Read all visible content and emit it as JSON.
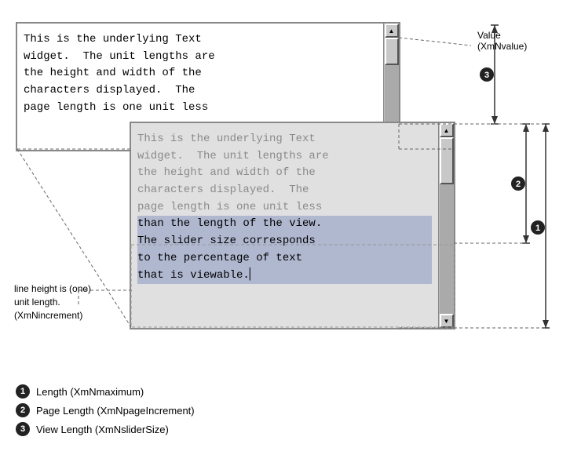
{
  "top_widget": {
    "text": "This is the underlying Text\nwidget.  The unit lengths are\nthe height and width of the\ncharacters displayed.  The\npage length is one unit less"
  },
  "bottom_widget": {
    "text_normal": "This is the underlying Text\nwidget.  The unit lengths are\nthe height and width of the\ncharacters displayed.  The\npage length is one unit less",
    "text_highlighted": "than the length of the view.\nThe slider size corresponds\nto the percentage of text\nthat is viewable.|"
  },
  "value_label": {
    "title": "Value",
    "subtitle": "(XmNvalue)"
  },
  "badges": {
    "one": "1",
    "two": "2",
    "three": "3"
  },
  "legend": [
    {
      "num": "1",
      "text": "Length (XmNmaximum)"
    },
    {
      "num": "2",
      "text": "Page Length (XmNpageIncrement)"
    },
    {
      "num": "3",
      "text": "View Length (XmNsliderSize)"
    }
  ],
  "left_annotation": {
    "line1": "line height is (one)",
    "line2": "unit length.",
    "line3": "(XmNincrement)"
  }
}
